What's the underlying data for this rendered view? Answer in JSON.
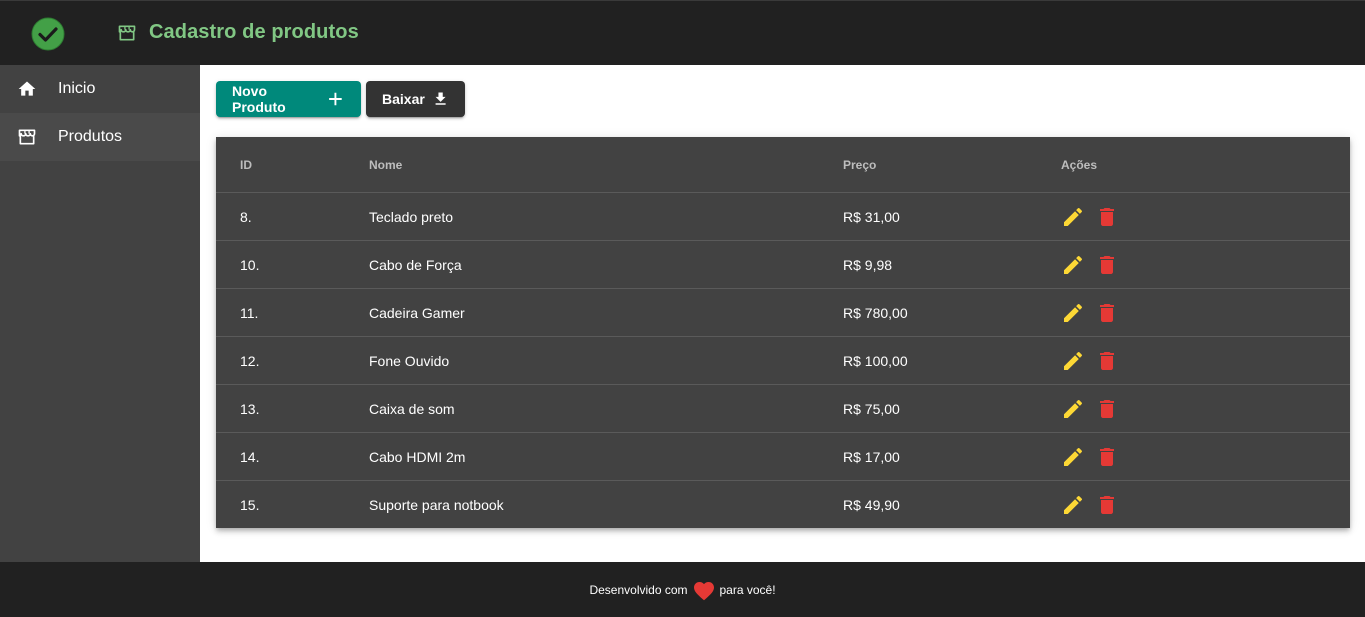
{
  "header": {
    "title": "Cadastro de produtos",
    "logo_icon": "check-circle-icon",
    "title_icon": "store-icon",
    "accent_color": "#81c784",
    "logo_color": "#43a047"
  },
  "sidebar": {
    "items": [
      {
        "label": "Inicio",
        "icon": "home-icon",
        "active": false
      },
      {
        "label": "Produtos",
        "icon": "store-icon",
        "active": true
      }
    ]
  },
  "toolbar": {
    "new_label": "Novo Produto",
    "new_icon": "plus-icon",
    "new_color": "#00897b",
    "download_label": "Baixar",
    "download_icon": "download-icon"
  },
  "table": {
    "headers": {
      "id": "ID",
      "name": "Nome",
      "price": "Preço",
      "actions": "Ações"
    },
    "rows": [
      {
        "id": "8.",
        "name": "Teclado preto",
        "price": "R$ 31,00"
      },
      {
        "id": "10.",
        "name": "Cabo de Força",
        "price": "R$ 9,98"
      },
      {
        "id": "11.",
        "name": "Cadeira Gamer",
        "price": "R$ 780,00"
      },
      {
        "id": "12.",
        "name": "Fone Ouvido",
        "price": "R$ 100,00"
      },
      {
        "id": "13.",
        "name": "Caixa de som",
        "price": "R$ 75,00"
      },
      {
        "id": "14.",
        "name": "Cabo HDMI 2m",
        "price": "R$ 17,00"
      },
      {
        "id": "15.",
        "name": "Suporte para notbook",
        "price": "R$ 49,90"
      }
    ],
    "edit_icon": "pencil-icon",
    "delete_icon": "trash-icon",
    "edit_color": "#fdd835",
    "delete_color": "#e53935"
  },
  "footer": {
    "text_before": "Desenvolvido com",
    "text_after": "para você!",
    "heart_icon": "heart-icon",
    "heart_color": "#e53935"
  }
}
